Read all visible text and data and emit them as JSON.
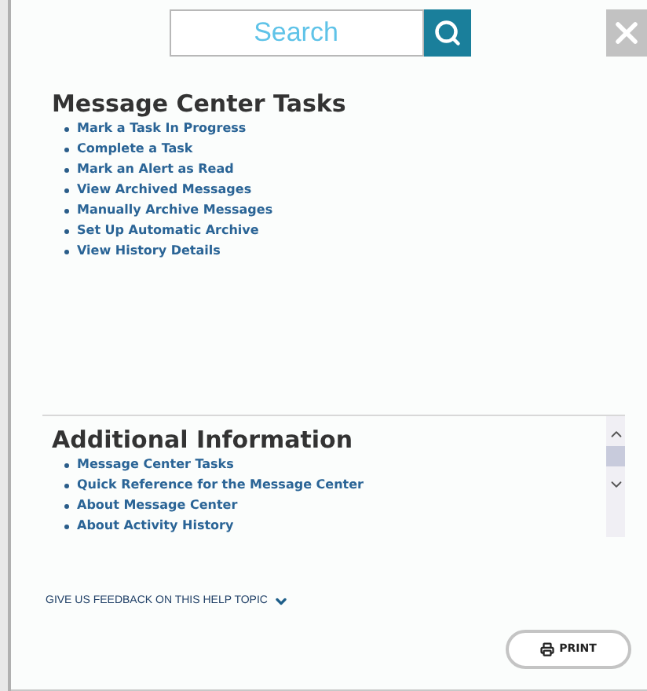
{
  "search": {
    "placeholder": "Search"
  },
  "tasks": {
    "title": "Message Center Tasks",
    "links": [
      "Mark a Task In Progress",
      "Complete a Task",
      "Mark an Alert as Read",
      "View Archived Messages",
      "Manually Archive Messages",
      "Set Up Automatic Archive",
      "View History Details"
    ]
  },
  "additional": {
    "title": "Additional Information",
    "links": [
      "Message Center Tasks",
      "Quick Reference for the Message Center",
      "About Message Center",
      "About Activity History"
    ]
  },
  "feedback": {
    "label": "GIVE US FEEDBACK ON THIS HELP TOPIC",
    "expanded": false
  },
  "print_button": "PRINT"
}
